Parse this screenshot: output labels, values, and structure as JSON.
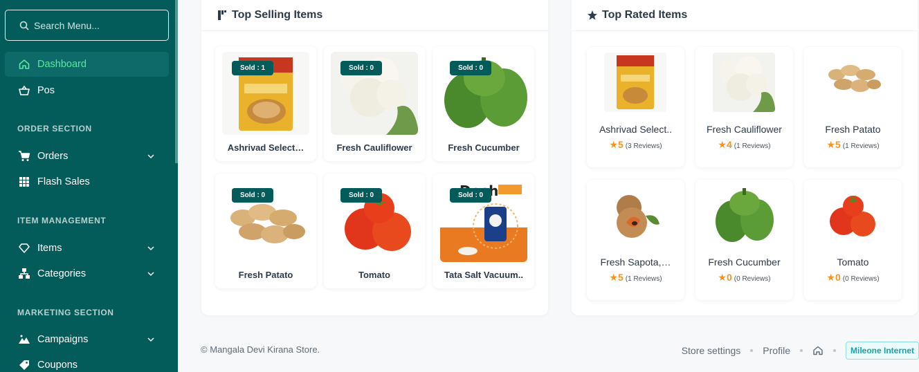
{
  "sidebar": {
    "search_placeholder": "Search Menu...",
    "items": {
      "dashboard": "Dashboard",
      "pos": "Pos",
      "orders": "Orders",
      "flash_sales": "Flash Sales",
      "items": "Items",
      "categories": "Categories",
      "campaigns": "Campaigns",
      "coupons": "Coupons"
    },
    "sections": {
      "order": "ORDER SECTION",
      "item": "ITEM MANAGEMENT",
      "marketing": "MARKETING SECTION"
    }
  },
  "top_selling": {
    "title": "Top Selling Items",
    "items": [
      {
        "name": "Ashrivad Select…",
        "badge": "Sold : 1"
      },
      {
        "name": "Fresh Cauliflower",
        "badge": "Sold : 0"
      },
      {
        "name": "Fresh Cucumber",
        "badge": "Sold : 0"
      },
      {
        "name": "Fresh Patato",
        "badge": "Sold : 0"
      },
      {
        "name": "Tomato",
        "badge": "Sold : 0"
      },
      {
        "name": "Tata Salt Vacuum..",
        "badge": "Sold : 0"
      }
    ]
  },
  "top_rated": {
    "title": "Top Rated Items",
    "items": [
      {
        "name": "Ashrivad Select..",
        "rating": "5",
        "reviews": "(3 Reviews)"
      },
      {
        "name": "Fresh Cauliflower",
        "rating": "4",
        "reviews": "(1 Reviews)"
      },
      {
        "name": "Fresh Patato",
        "rating": "5",
        "reviews": "(1 Reviews)"
      },
      {
        "name": "Fresh Sapota,…",
        "rating": "5",
        "reviews": "(1 Reviews)"
      },
      {
        "name": "Fresh Cucumber",
        "rating": "0",
        "reviews": "(0 Reviews)"
      },
      {
        "name": "Tomato",
        "rating": "0",
        "reviews": "(0 Reviews)"
      }
    ]
  },
  "footer": {
    "copyright": "© Mangala Devi Kirana Store.",
    "store_settings": "Store settings",
    "profile": "Profile",
    "company": "Mileone Internet"
  },
  "colors": {
    "sidebar_bg": "#045c5a",
    "active_text": "#5ce8a0",
    "badge_bg": "#045c5a",
    "star": "#f7931e"
  }
}
